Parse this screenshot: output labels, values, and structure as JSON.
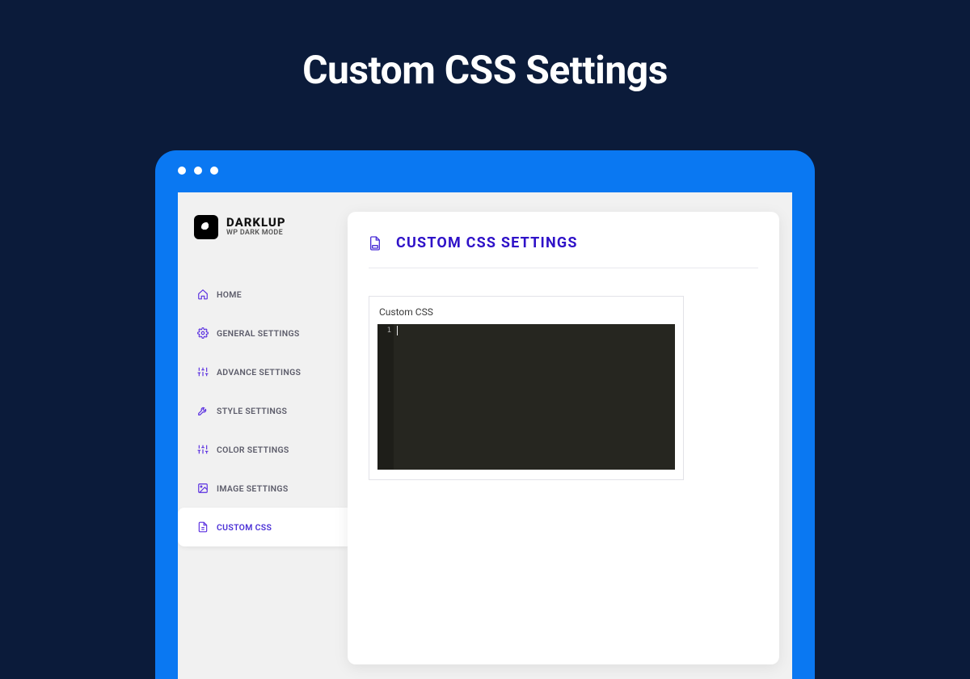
{
  "hero": {
    "title": "Custom CSS Settings"
  },
  "brand": {
    "name": "DARKLUP",
    "subtitle": "WP DARK MODE"
  },
  "sidebar": {
    "items": [
      {
        "label": "HOME"
      },
      {
        "label": "GENERAL SETTINGS"
      },
      {
        "label": "ADVANCE SETTINGS"
      },
      {
        "label": "STYLE SETTINGS"
      },
      {
        "label": "COLOR SETTINGS"
      },
      {
        "label": "IMAGE SETTINGS"
      },
      {
        "label": "CUSTOM CSS"
      }
    ],
    "active_index": 6
  },
  "panel": {
    "title": "CUSTOM CSS SETTINGS",
    "field_label": "Custom CSS",
    "editor": {
      "line_number": "1"
    }
  }
}
